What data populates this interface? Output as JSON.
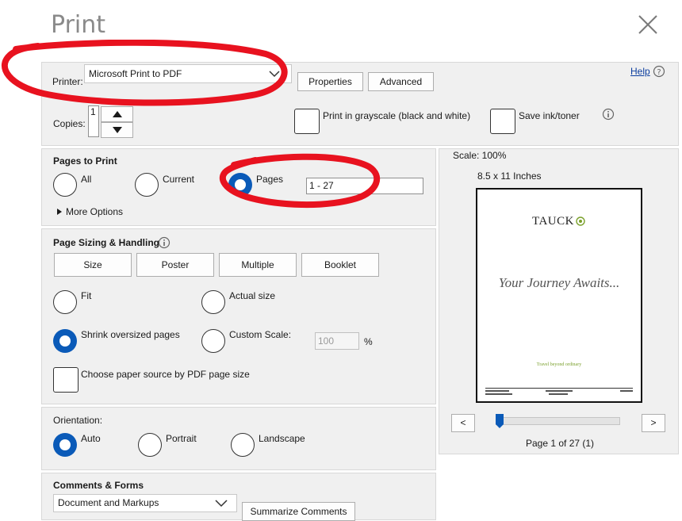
{
  "dialog": {
    "title": "Print",
    "close_icon": "close-icon"
  },
  "printer": {
    "label": "Printer:",
    "selected": "Microsoft Print to PDF",
    "properties_label": "Properties",
    "advanced_label": "Advanced",
    "help_label": "Help",
    "copies_label": "Copies:",
    "copies_value": "1",
    "grayscale_label": "Print in grayscale (black and white)",
    "save_ink_label": "Save ink/toner"
  },
  "pages_to_print": {
    "heading": "Pages to Print",
    "all_label": "All",
    "current_label": "Current",
    "pages_label": "Pages",
    "pages_value": "1 - 27",
    "selected": "pages",
    "more_options_label": "More Options"
  },
  "page_sizing": {
    "heading": "Page Sizing & Handling",
    "size_label": "Size",
    "poster_label": "Poster",
    "multiple_label": "Multiple",
    "booklet_label": "Booklet",
    "fit_label": "Fit",
    "actual_size_label": "Actual size",
    "shrink_label": "Shrink oversized pages",
    "custom_scale_label": "Custom Scale:",
    "custom_scale_value": "100",
    "percent_label": "%",
    "paper_source_label": "Choose paper source by PDF page size",
    "selected": "shrink"
  },
  "orientation": {
    "heading": "Orientation:",
    "auto_label": "Auto",
    "portrait_label": "Portrait",
    "landscape_label": "Landscape",
    "selected": "auto"
  },
  "comments_forms": {
    "heading": "Comments & Forms",
    "selected": "Document and Markups",
    "summarize_label": "Summarize Comments"
  },
  "preview": {
    "scale_label": "Scale: 100%",
    "paper_size_label": "8.5 x 11 Inches",
    "page_brand": "TAUCK",
    "page_headline": "Your Journey Awaits...",
    "page_tagline": "Travel beyond ordinary",
    "page_status": "Page 1 of 27 (1)",
    "prev_label": "<",
    "next_label": ">",
    "page_index": 1,
    "page_count": 27
  },
  "colors": {
    "accent": "#0a5ab8",
    "annotation": "#e8121f",
    "panel": "#f0f0f0"
  }
}
